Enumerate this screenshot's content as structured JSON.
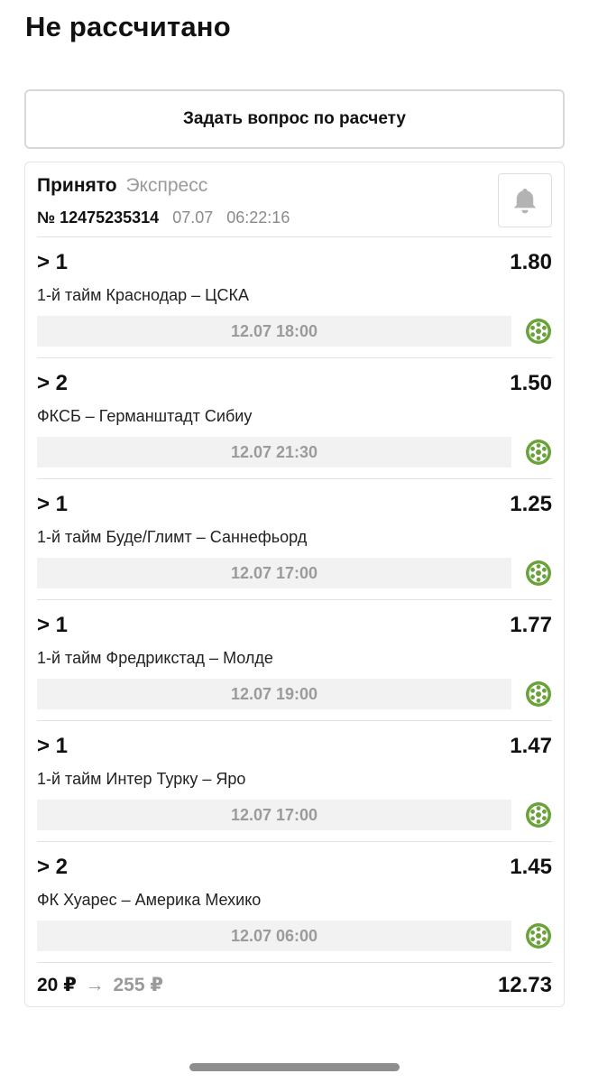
{
  "header": {
    "title": "Не рассчитано"
  },
  "ask_button": {
    "label": "Задать вопрос по расчету"
  },
  "bet": {
    "status": "Принято",
    "type": "Экспресс",
    "number": "№ 12475235314",
    "date": "07.07",
    "time": "06:22:16",
    "bell_icon": "bell-icon"
  },
  "events": [
    {
      "outcome": "> 1",
      "odds": "1.80",
      "name": "1-й тайм Краснодар – ЦСКА",
      "datetime": "12.07 18:00",
      "sport_icon": "football-icon"
    },
    {
      "outcome": "> 2",
      "odds": "1.50",
      "name": "ФКСБ – Германштадт Сибиу",
      "datetime": "12.07 21:30",
      "sport_icon": "football-icon"
    },
    {
      "outcome": "> 1",
      "odds": "1.25",
      "name": "1-й тайм Буде/Глимт – Саннефьорд",
      "datetime": "12.07 17:00",
      "sport_icon": "football-icon"
    },
    {
      "outcome": "> 1",
      "odds": "1.77",
      "name": "1-й тайм Фредрикстад – Молде",
      "datetime": "12.07 19:00",
      "sport_icon": "football-icon"
    },
    {
      "outcome": "> 1",
      "odds": "1.47",
      "name": "1-й тайм Интер Турку – Яро",
      "datetime": "12.07 17:00",
      "sport_icon": "football-icon"
    },
    {
      "outcome": "> 2",
      "odds": "1.45",
      "name": "ФК Хуарес – Америка Мехико",
      "datetime": "12.07 06:00",
      "sport_icon": "football-icon"
    }
  ],
  "footer": {
    "stake": "20 ₽",
    "arrow": "→",
    "payout": "255 ₽",
    "total_odds": "12.73"
  },
  "colors": {
    "text": "#111111",
    "muted": "#9a9a9a",
    "date_bar": "#f2f2f2",
    "sport_icon": "#6aa23a",
    "bell_icon": "#b3b3b3"
  }
}
